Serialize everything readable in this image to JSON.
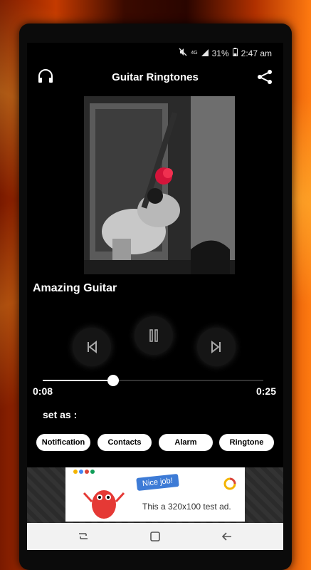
{
  "status_bar": {
    "network": "4G",
    "battery": "31%",
    "time": "2:47 am"
  },
  "app_bar": {
    "title": "Guitar Ringtones",
    "left_icon": "headphones-icon",
    "right_icon": "share-icon"
  },
  "player": {
    "song_title": "Amazing Guitar",
    "elapsed": "0:08",
    "duration": "0:25",
    "progress_fraction": 0.32
  },
  "set_as": {
    "label": "set as :",
    "options": [
      "Notification",
      "Contacts",
      "Alarm",
      "Ringtone"
    ]
  },
  "ad": {
    "badge": "Nice job!",
    "text": "This a 320x100 test ad."
  },
  "colors": {
    "background": "#000000",
    "accent": "#ffffff"
  }
}
